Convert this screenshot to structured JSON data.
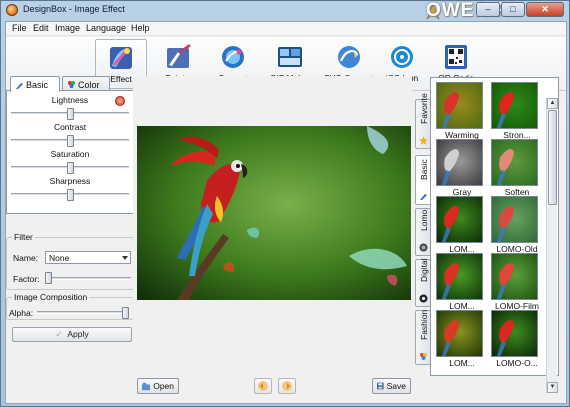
{
  "window": {
    "title": "DesignBox - Image Effect",
    "watermark": "OWER.RU"
  },
  "menu": {
    "items": [
      "File",
      "Edit",
      "Image",
      "Language",
      "Help"
    ]
  },
  "toolbar": {
    "tools": [
      {
        "label": "Effect",
        "icon": "effect-brush-icon",
        "active": true
      },
      {
        "label": "Painter",
        "icon": "painter-brush-icon",
        "active": false
      },
      {
        "label": "Convert",
        "icon": "convert-icon",
        "active": false
      },
      {
        "label": "GIF Maker",
        "icon": "gif-maker-icon",
        "active": false
      },
      {
        "label": "SVG Convert",
        "icon": "svg-convert-icon",
        "active": false
      },
      {
        "label": "iOS Icon",
        "icon": "ios-icon-icon",
        "active": false
      },
      {
        "label": "QR Code",
        "icon": "qr-code-icon",
        "active": false
      }
    ]
  },
  "left_panel": {
    "tabs": [
      {
        "label": "Basic",
        "active": true
      },
      {
        "label": "Color",
        "active": false
      }
    ],
    "sliders": [
      {
        "label": "Lightness",
        "value": 0.5
      },
      {
        "label": "Contrast",
        "value": 0.5
      },
      {
        "label": "Saturation",
        "value": 0.5
      },
      {
        "label": "Sharpness",
        "value": 0.5
      }
    ],
    "filter": {
      "legend": "Filter",
      "name_label": "Name:",
      "name_value": "None",
      "factor_label": "Factor:",
      "factor_value": 0.0
    },
    "composition": {
      "legend": "Image Composition",
      "alpha_label": "Alpha:",
      "alpha_value": 1.0
    },
    "apply_label": "Apply"
  },
  "center": {
    "open_label": "Open",
    "save_label": "Save"
  },
  "right_panel": {
    "vertical_tabs": [
      {
        "label": "Favorite",
        "active": false
      },
      {
        "label": "Basic",
        "active": true
      },
      {
        "label": "Lomo",
        "active": false
      },
      {
        "label": "Digital",
        "active": false
      },
      {
        "label": "Fashion",
        "active": false
      }
    ],
    "thumbnails": [
      {
        "label": "Warming",
        "tone": "warm"
      },
      {
        "label": "Stron...",
        "tone": "strong"
      },
      {
        "label": "Gray",
        "tone": "gray"
      },
      {
        "label": "Soften",
        "tone": "soft"
      },
      {
        "label": "LOM...",
        "tone": "lomo"
      },
      {
        "label": "LOMO-Old",
        "tone": "old"
      },
      {
        "label": "LOM...",
        "tone": "lomo2"
      },
      {
        "label": "LOMO-Film",
        "tone": "film"
      },
      {
        "label": "LOM...",
        "tone": "lomo3"
      },
      {
        "label": "LOMO-O...",
        "tone": "lomo4"
      }
    ]
  },
  "colors": {
    "accent": "#3a78c0",
    "image_green": "#3f7a1a"
  }
}
